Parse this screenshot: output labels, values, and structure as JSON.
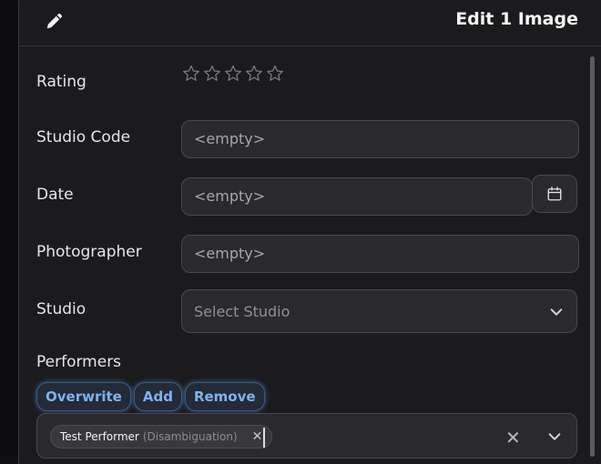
{
  "header": {
    "title": "Edit 1 Image",
    "icon": "pencil-icon"
  },
  "fields": {
    "rating": {
      "label": "Rating",
      "value": 0,
      "max": 5
    },
    "studio_code": {
      "label": "Studio Code",
      "placeholder": "<empty>"
    },
    "date": {
      "label": "Date",
      "placeholder": "<empty>"
    },
    "photographer": {
      "label": "Photographer",
      "placeholder": "<empty>"
    },
    "studio": {
      "label": "Studio",
      "placeholder": "Select Studio"
    }
  },
  "performers": {
    "label": "Performers",
    "modes": [
      "Overwrite",
      "Add",
      "Remove"
    ],
    "tags": [
      {
        "name": "Test Performer",
        "disambiguation": "(Disambiguation)"
      }
    ]
  },
  "colors": {
    "background": "#1b1b1e",
    "field": "#2a2a2e",
    "accent": "#7fb2f0"
  }
}
